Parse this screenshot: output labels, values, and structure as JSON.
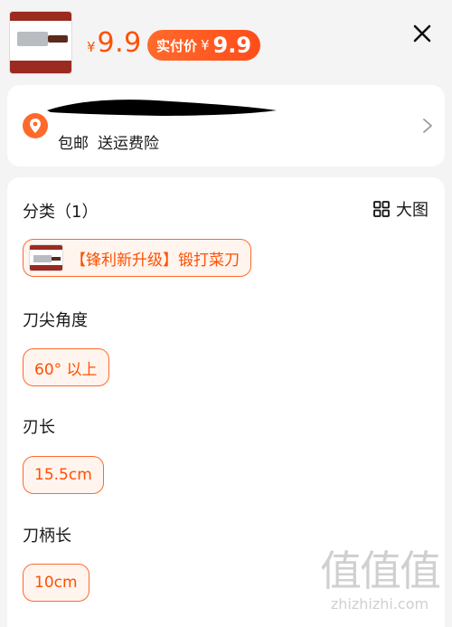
{
  "product": {
    "currency": "¥",
    "price": "9.9",
    "pay_label": "实付价",
    "pay_price": "9.9"
  },
  "address": {
    "shipping_tags": [
      "包邮",
      "送运费险"
    ]
  },
  "options": {
    "big_view_label": "大图",
    "groups": [
      {
        "title": "分类（1）",
        "selected": "【锋利新升级】锻打菜刀"
      },
      {
        "title": "刀尖角度",
        "selected": "60° 以上"
      },
      {
        "title": "刃长",
        "selected": "15.5cm"
      },
      {
        "title": "刀柄长",
        "selected": "10cm"
      }
    ]
  },
  "watermark": {
    "marks": "值值值",
    "site": "zhizhizhi.com"
  },
  "colors": {
    "accent": "#ff5000",
    "chip_bg": "#fff4ee",
    "page_bg": "#f4f4f4"
  }
}
